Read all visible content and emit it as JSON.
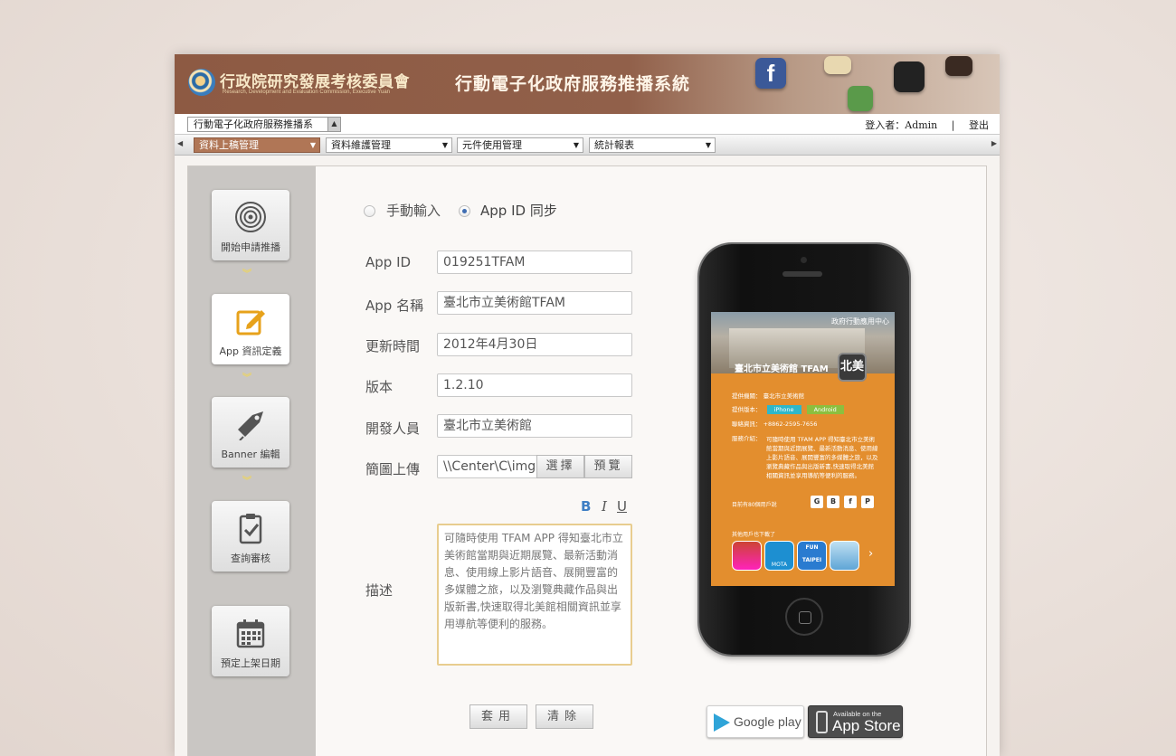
{
  "header": {
    "org_name": "行政院研究發展考核委員會",
    "org_name_en": "Research, Development and Evaluation Commission, Executive Yuan",
    "system_title": "行動電子化政府服務推播系統"
  },
  "titlebar": {
    "system_select_value": "行動電子化政府服務推播系",
    "login_label": "登入者：Admin",
    "logout_label": "登出"
  },
  "menu": {
    "items": [
      {
        "label": "資料上稿管理",
        "active": true
      },
      {
        "label": "資料維護管理",
        "active": false
      },
      {
        "label": "元件使用管理",
        "active": false
      },
      {
        "label": "統計報表",
        "active": false
      }
    ]
  },
  "steps": [
    {
      "label": "開始申請推播",
      "icon": "target-icon"
    },
    {
      "label": "App 資訊定義",
      "icon": "edit-icon"
    },
    {
      "label": "Banner 編輯",
      "icon": "tag-icon"
    },
    {
      "label": "查詢審核",
      "icon": "clipboard-check-icon"
    },
    {
      "label": "預定上架日期",
      "icon": "calendar-icon"
    }
  ],
  "form": {
    "mode_manual": "手動輸入",
    "mode_sync": "App ID 同步",
    "mode_selected": "sync",
    "fields": [
      {
        "label": "App ID",
        "value": "019251TFAM"
      },
      {
        "label": "App 名稱",
        "value": "臺北市立美術館TFAM"
      },
      {
        "label": "更新時間",
        "value": "2012年4月30日"
      },
      {
        "label": "版本",
        "value": "1.2.10"
      },
      {
        "label": "開發人員",
        "value": "臺北市立美術館"
      }
    ],
    "upload_label": "簡圖上傳",
    "upload_value": "\\\\Center\\C\\img",
    "choose_button": "選擇",
    "preview_button": "預覽",
    "format_bold": "B",
    "format_italic": "I",
    "format_underline": "U",
    "desc_label": "描述",
    "desc_value": "可隨時使用 TFAM APP 得知臺北市立美術館當期與近期展覽、最新活動消息、使用線上影片語音、展開豐富的多媒體之旅，以及瀏覽典藏作品與出版新書,快速取得北美館相關資訊並享用導航等便利的服務。",
    "apply_button": "套用",
    "clear_button": "清除"
  },
  "phone_preview": {
    "header": "政府行動應用中心",
    "app_name": "臺北市立美術館 TFAM",
    "logo_text": "北美",
    "provider_label": "提供機關：",
    "provider_value": "臺北市立美術館",
    "version_label": "提供版本：",
    "iphone_label": "iPhone",
    "android_label": "Android",
    "contact_label": "聯絡資訊：",
    "contact_value": "+8862-2595-7656",
    "service_label": "服務介紹：",
    "service_value": "可隨時使用 TFAM APP 得知臺北市立美術館當期與近期展覽、最新活動消息、使用線上影片語音、展開豐富的多媒體之旅，以及瀏覽典藏作品與出版新書,快速取得北美館相關資訊並享用導航等便利的服務。",
    "users_text": "目前有80個用戶說",
    "other_users": "其他用戶也下載了",
    "mini_apps": [
      "MOTA",
      "FUN TAIPEI"
    ]
  },
  "stores": {
    "google_play": "Google play",
    "app_store_small": "Available on the",
    "app_store_big": "App Store"
  },
  "colors": {
    "banner_brown": "#8d5a43",
    "active_menu": "#b07656",
    "phone_screen_orange": "#e38e2e",
    "radio_selected": "#3f6db2"
  }
}
